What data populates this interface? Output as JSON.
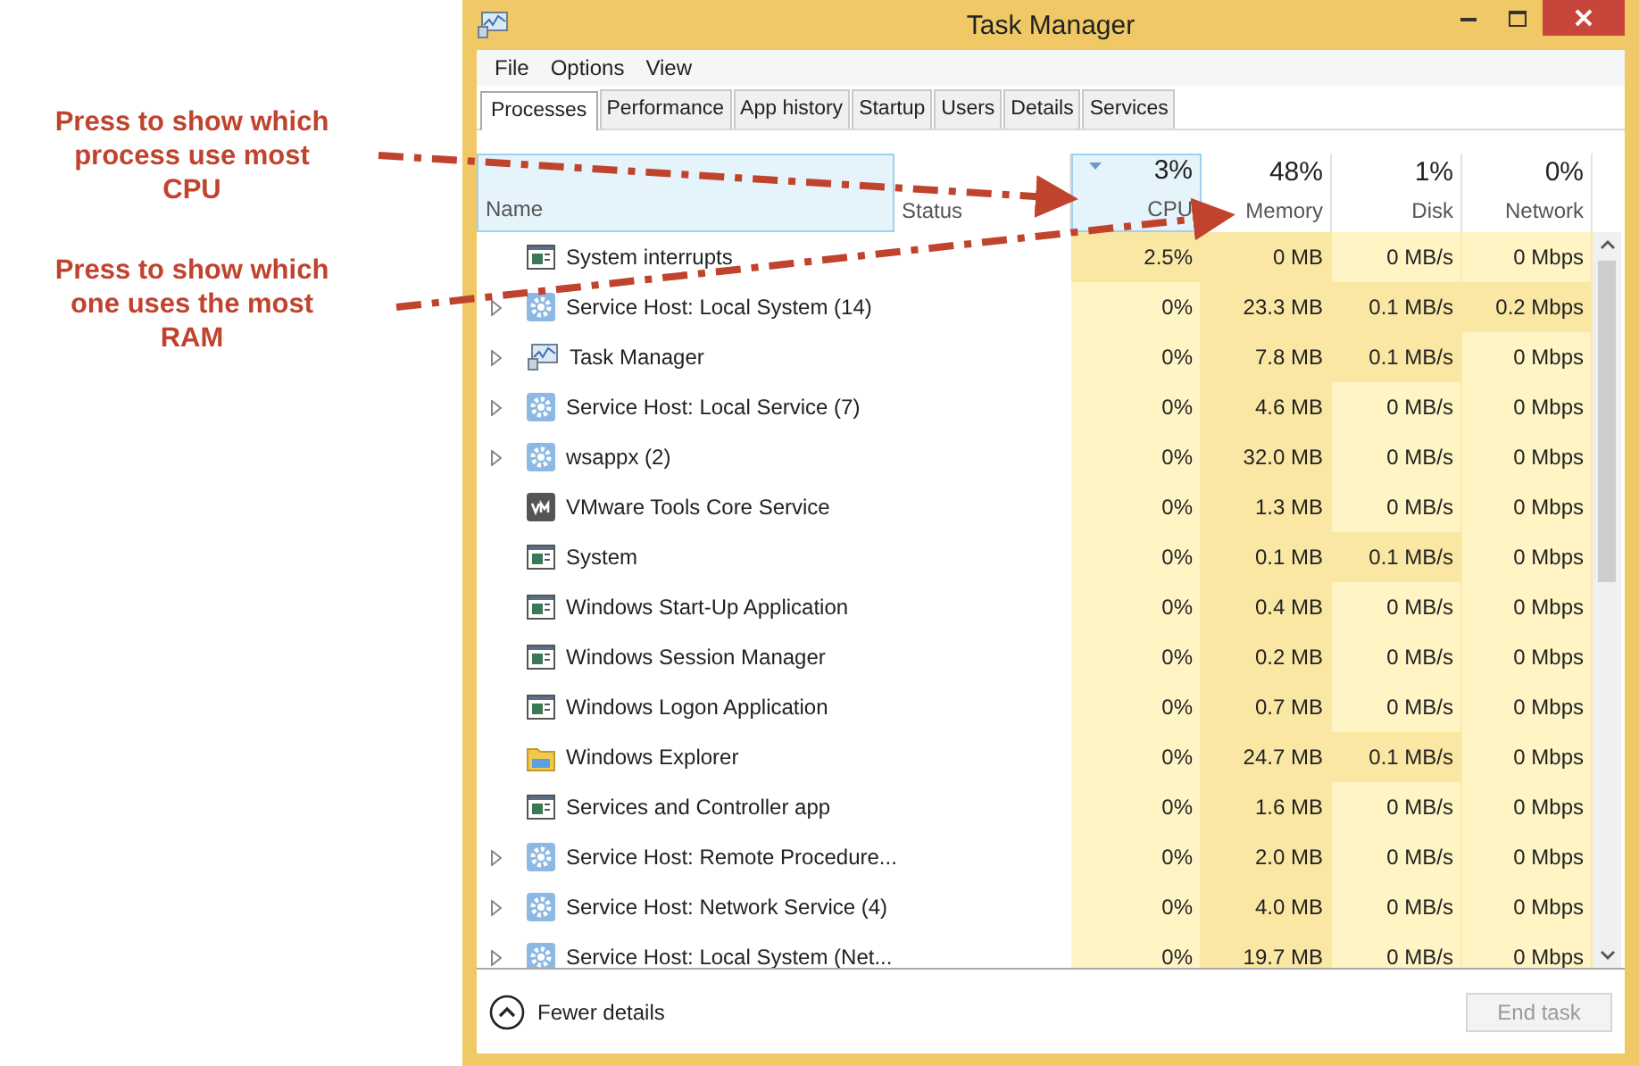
{
  "annotations": [
    {
      "text": "Press to show which process use most CPU"
    },
    {
      "text": "Press to show which one uses the most RAM"
    }
  ],
  "window": {
    "title": "Task Manager"
  },
  "menu": [
    "File",
    "Options",
    "View"
  ],
  "tabs": [
    {
      "label": "Processes",
      "selected": true
    },
    {
      "label": "Performance",
      "selected": false
    },
    {
      "label": "App history",
      "selected": false
    },
    {
      "label": "Startup",
      "selected": false
    },
    {
      "label": "Users",
      "selected": false
    },
    {
      "label": "Details",
      "selected": false
    },
    {
      "label": "Services",
      "selected": false
    }
  ],
  "columns": [
    {
      "label": "Name",
      "selected": true
    },
    {
      "label": "Status",
      "selected": false
    },
    {
      "label": "CPU",
      "percent": "3%",
      "selected": true
    },
    {
      "label": "Memory",
      "percent": "48%",
      "selected": false
    },
    {
      "label": "Disk",
      "percent": "1%",
      "selected": false
    },
    {
      "label": "Network",
      "percent": "0%",
      "selected": false
    }
  ],
  "rows": [
    {
      "name": "System interrupts",
      "kind": "window",
      "expandable": false,
      "cells": [
        {
          "text": "2.5%",
          "hot": true
        },
        {
          "text": "0 MB",
          "hot": true
        },
        {
          "text": "0 MB/s",
          "hot": false
        },
        {
          "text": "0 Mbps",
          "hot": false
        }
      ]
    },
    {
      "name": "Service Host: Local System (14)",
      "kind": "gear",
      "expandable": true,
      "cells": [
        {
          "text": "0%",
          "hot": false
        },
        {
          "text": "23.3 MB",
          "hot": true
        },
        {
          "text": "0.1 MB/s",
          "hot": true
        },
        {
          "text": "0.2 Mbps",
          "hot": true
        }
      ]
    },
    {
      "name": "Task Manager",
      "kind": "monitor",
      "expandable": true,
      "cells": [
        {
          "text": "0%",
          "hot": false
        },
        {
          "text": "7.8 MB",
          "hot": true
        },
        {
          "text": "0.1 MB/s",
          "hot": true
        },
        {
          "text": "0 Mbps",
          "hot": false
        }
      ]
    },
    {
      "name": "Service Host: Local Service (7)",
      "kind": "gear",
      "expandable": true,
      "cells": [
        {
          "text": "0%",
          "hot": false
        },
        {
          "text": "4.6 MB",
          "hot": true
        },
        {
          "text": "0 MB/s",
          "hot": false
        },
        {
          "text": "0 Mbps",
          "hot": false
        }
      ]
    },
    {
      "name": "wsappx (2)",
      "kind": "gear",
      "expandable": true,
      "cells": [
        {
          "text": "0%",
          "hot": false
        },
        {
          "text": "32.0 MB",
          "hot": true
        },
        {
          "text": "0 MB/s",
          "hot": false
        },
        {
          "text": "0 Mbps",
          "hot": false
        }
      ]
    },
    {
      "name": "VMware Tools Core Service",
      "kind": "vm",
      "expandable": false,
      "cells": [
        {
          "text": "0%",
          "hot": false
        },
        {
          "text": "1.3 MB",
          "hot": true
        },
        {
          "text": "0 MB/s",
          "hot": false
        },
        {
          "text": "0 Mbps",
          "hot": false
        }
      ]
    },
    {
      "name": "System",
      "kind": "window",
      "expandable": false,
      "cells": [
        {
          "text": "0%",
          "hot": false
        },
        {
          "text": "0.1 MB",
          "hot": true
        },
        {
          "text": "0.1 MB/s",
          "hot": true
        },
        {
          "text": "0 Mbps",
          "hot": false
        }
      ]
    },
    {
      "name": "Windows Start-Up Application",
      "kind": "window",
      "expandable": false,
      "cells": [
        {
          "text": "0%",
          "hot": false
        },
        {
          "text": "0.4 MB",
          "hot": true
        },
        {
          "text": "0 MB/s",
          "hot": false
        },
        {
          "text": "0 Mbps",
          "hot": false
        }
      ]
    },
    {
      "name": "Windows Session Manager",
      "kind": "window",
      "expandable": false,
      "cells": [
        {
          "text": "0%",
          "hot": false
        },
        {
          "text": "0.2 MB",
          "hot": true
        },
        {
          "text": "0 MB/s",
          "hot": false
        },
        {
          "text": "0 Mbps",
          "hot": false
        }
      ]
    },
    {
      "name": "Windows Logon Application",
      "kind": "window",
      "expandable": false,
      "cells": [
        {
          "text": "0%",
          "hot": false
        },
        {
          "text": "0.7 MB",
          "hot": true
        },
        {
          "text": "0 MB/s",
          "hot": false
        },
        {
          "text": "0 Mbps",
          "hot": false
        }
      ]
    },
    {
      "name": "Windows Explorer",
      "kind": "folder",
      "expandable": false,
      "cells": [
        {
          "text": "0%",
          "hot": false
        },
        {
          "text": "24.7 MB",
          "hot": true
        },
        {
          "text": "0.1 MB/s",
          "hot": true
        },
        {
          "text": "0 Mbps",
          "hot": false
        }
      ]
    },
    {
      "name": "Services and Controller app",
      "kind": "window",
      "expandable": false,
      "cells": [
        {
          "text": "0%",
          "hot": false
        },
        {
          "text": "1.6 MB",
          "hot": true
        },
        {
          "text": "0 MB/s",
          "hot": false
        },
        {
          "text": "0 Mbps",
          "hot": false
        }
      ]
    },
    {
      "name": "Service Host: Remote Procedure...",
      "kind": "gear",
      "expandable": true,
      "cells": [
        {
          "text": "0%",
          "hot": false
        },
        {
          "text": "2.0 MB",
          "hot": true
        },
        {
          "text": "0 MB/s",
          "hot": false
        },
        {
          "text": "0 Mbps",
          "hot": false
        }
      ]
    },
    {
      "name": "Service Host: Network Service (4)",
      "kind": "gear",
      "expandable": true,
      "cells": [
        {
          "text": "0%",
          "hot": false
        },
        {
          "text": "4.0 MB",
          "hot": true
        },
        {
          "text": "0 MB/s",
          "hot": false
        },
        {
          "text": "0 Mbps",
          "hot": false
        }
      ]
    },
    {
      "name": "Service Host: Local System (Net...",
      "kind": "gear",
      "expandable": true,
      "cells": [
        {
          "text": "0%",
          "hot": false
        },
        {
          "text": "19.7 MB",
          "hot": true
        },
        {
          "text": "0 MB/s",
          "hot": false
        },
        {
          "text": "0 Mbps",
          "hot": false
        }
      ]
    }
  ],
  "footer": {
    "toggle": "Fewer details",
    "button": {
      "label": "End task",
      "disabled": true
    }
  }
}
